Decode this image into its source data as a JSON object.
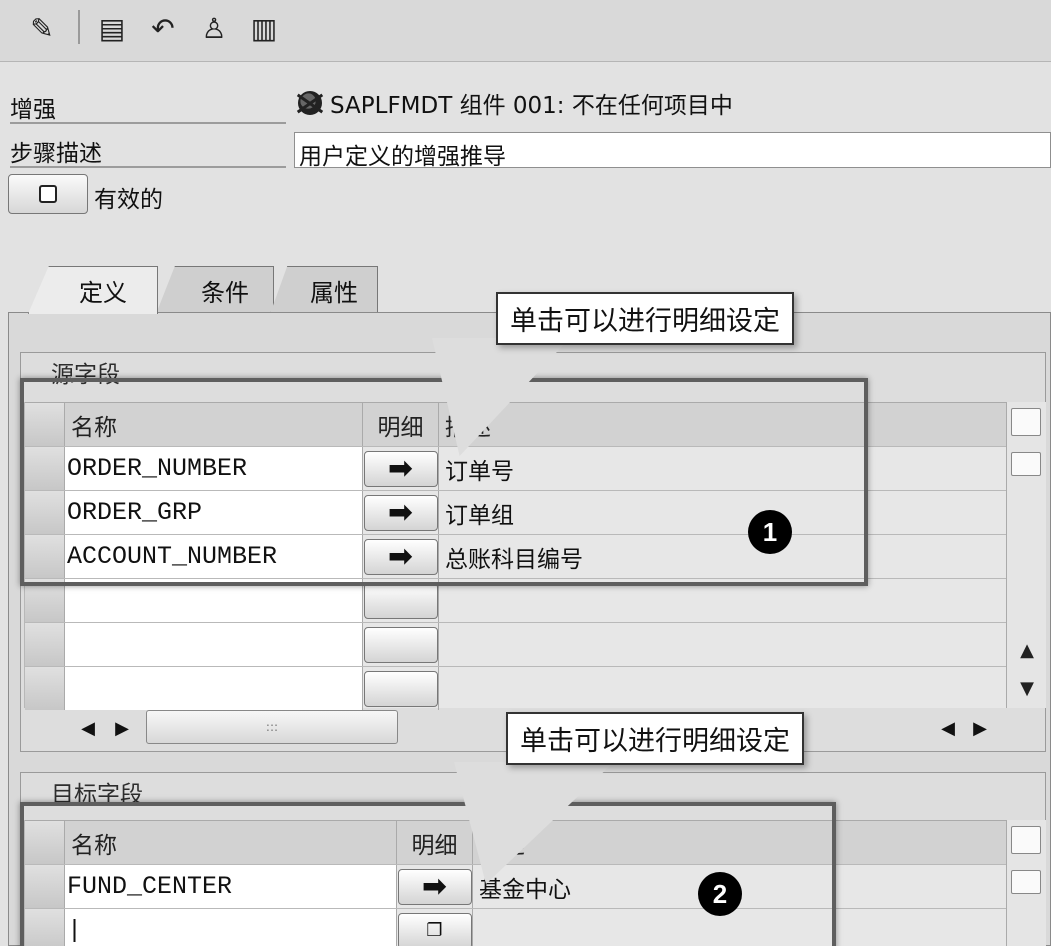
{
  "toolbar": {
    "icons": [
      "edit-pencil-icon",
      "save-icon",
      "undo-icon",
      "user-icon",
      "document-icon"
    ]
  },
  "header": {
    "enhancement_label": "增强",
    "enhancement_value": "SAPLFMDT 组件 001: 不在任何项目中",
    "step_label": "步骤描述",
    "step_value": "用户定义的增强推导",
    "active_label": "有效的"
  },
  "tabs": {
    "definition": "定义",
    "conditions": "条件",
    "attributes": "属性"
  },
  "source": {
    "title": "源字段",
    "col_name": "名称",
    "col_detail": "明细",
    "col_desc": "描述",
    "rows": [
      {
        "name": "ORDER_NUMBER",
        "desc": "订单号"
      },
      {
        "name": "ORDER_GRP",
        "desc": "订单组"
      },
      {
        "name": "ACCOUNT_NUMBER",
        "desc": "总账科目编号"
      }
    ]
  },
  "target": {
    "title": "目标字段",
    "col_name": "名称",
    "col_detail": "明细",
    "col_desc": "描述",
    "rows": [
      {
        "name": "FUND_CENTER",
        "desc": "基金中心"
      }
    ]
  },
  "annotations": {
    "callout_1": "单击可以进行明细设定",
    "callout_2": "单击可以进行明细设定",
    "marker_1": "1",
    "marker_2": "2"
  },
  "colors": {
    "background": "#d6d6d6",
    "highlight": "#5e5e5e",
    "marker": "#000000"
  }
}
